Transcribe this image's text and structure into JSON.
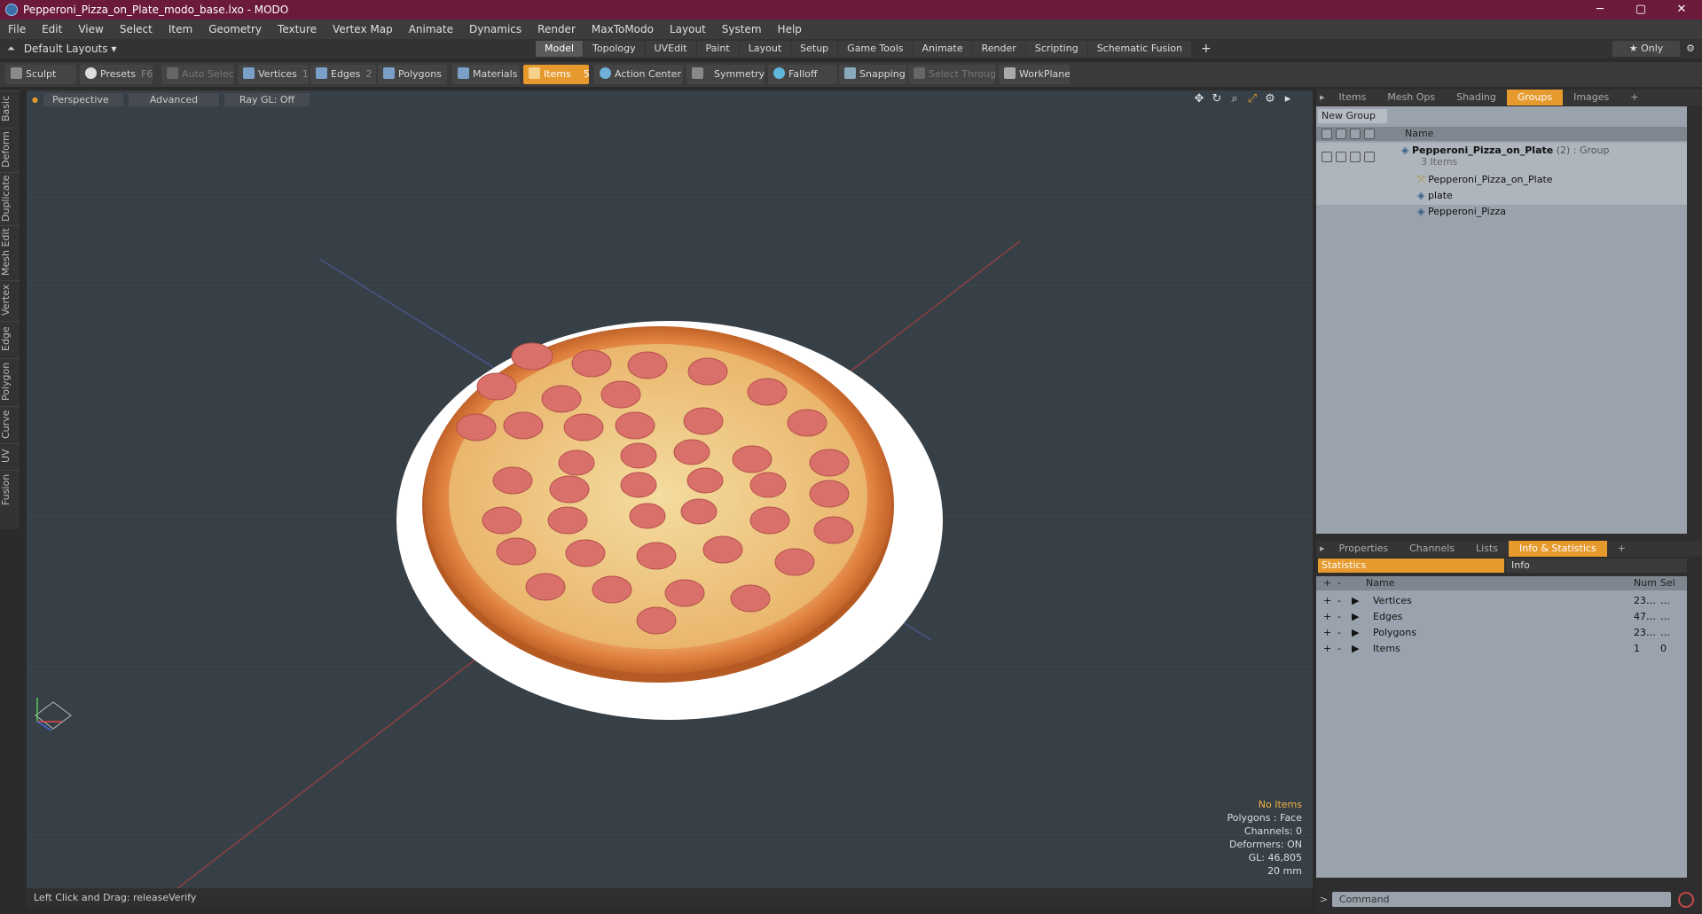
{
  "window": {
    "title": "Pepperoni_Pizza_on_Plate_modo_base.lxo - MODO",
    "min": "─",
    "max": "▢",
    "close": "✕"
  },
  "menu": [
    "File",
    "Edit",
    "View",
    "Select",
    "Item",
    "Geometry",
    "Texture",
    "Vertex Map",
    "Animate",
    "Dynamics",
    "Render",
    "MaxToModo",
    "Layout",
    "System",
    "Help"
  ],
  "layoutbar": {
    "default_layouts": "Default Layouts ▾",
    "tabs": [
      "Model",
      "Topology",
      "UVEdit",
      "Paint",
      "Layout",
      "Setup",
      "Game Tools",
      "Animate",
      "Render",
      "Scripting",
      "Schematic Fusion"
    ],
    "active_tab": "Model",
    "add": "+",
    "only": "★  Only"
  },
  "toolbar": {
    "sculpt": "Sculpt",
    "presets": "Presets",
    "presets_key": "F6",
    "auto_select": "Auto Select",
    "vertices": "Vertices",
    "vertices_key": "1",
    "edges": "Edges",
    "edges_key": "2",
    "polygons": "Polygons",
    "materials": "Materials",
    "items": "Items",
    "items_key": "5",
    "action_center": "Action Center",
    "symmetry": "Symmetry",
    "falloff": "Falloff",
    "snapping": "Snapping",
    "select_through": "Select Through",
    "workplane": "WorkPlane"
  },
  "left_tabs": [
    "Basic",
    "Deform",
    "Duplicate",
    "Mesh Edit",
    "Vertex",
    "Edge",
    "Polygon",
    "Curve",
    "UV",
    "Fusion"
  ],
  "viewport": {
    "perspective": "Perspective",
    "advanced": "Advanced",
    "raygl": "Ray GL: Off",
    "info": {
      "no_items": "No Items",
      "polygons": "Polygons : Face",
      "channels": "Channels: 0",
      "deformers": "Deformers: ON",
      "gl": "GL: 46,805",
      "scale": "20 mm"
    }
  },
  "status": "Left Click and Drag:   releaseVerify",
  "groups_panel": {
    "tabs": [
      "Items",
      "Mesh Ops",
      "Shading",
      "Groups",
      "Images",
      "+"
    ],
    "active_tab": "Groups",
    "new_group": "New Group",
    "col_name": "Name",
    "root": "Pepperoni_Pizza_on_Plate",
    "root_suffix": " (2) : Group",
    "root_sub": "3 Items",
    "children": [
      "Pepperoni_Pizza_on_Plate",
      "plate",
      "Pepperoni_Pizza"
    ]
  },
  "props_panel": {
    "tabs": [
      "Properties",
      "Channels",
      "Lists",
      "Info & Statistics",
      "+"
    ],
    "active_tab": "Info & Statistics",
    "statistics": "Statistics",
    "info": "Info",
    "col_name": "Name",
    "col_num": "Num",
    "col_sel": "Sel",
    "rows": [
      {
        "name": "Vertices",
        "num": "23…",
        "sel": "…"
      },
      {
        "name": "Edges",
        "num": "47…",
        "sel": "…"
      },
      {
        "name": "Polygons",
        "num": "23…",
        "sel": "…"
      },
      {
        "name": "Items",
        "num": "1",
        "sel": "0"
      }
    ]
  },
  "command_placeholder": "Command",
  "colors": {
    "accent": "#e69a2e",
    "titlebar": "#6b1a3b",
    "viewport": "#384047"
  }
}
